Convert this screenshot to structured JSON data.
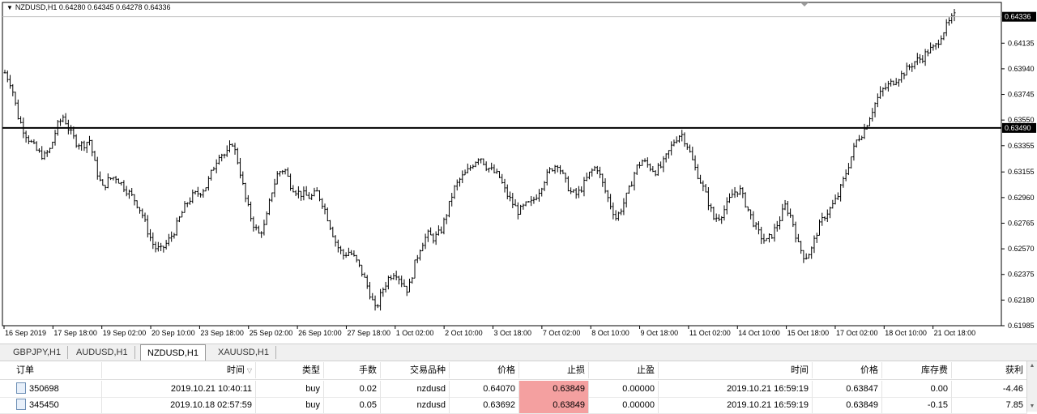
{
  "symbol_bar": {
    "arrow_icon": "dropdown-triangle-icon",
    "text": "NZDUSD,H1  0.64280 0.64345 0.64278 0.64336"
  },
  "chart_data": {
    "type": "bar",
    "title": "NZDUSD,H1",
    "ohlc_header": {
      "open": 0.6428,
      "high": 0.64345,
      "low": 0.64278,
      "close": 0.64336
    },
    "y_ticks": [
      "0.64135",
      "0.63940",
      "0.63745",
      "0.63550",
      "0.63355",
      "0.63155",
      "0.62960",
      "0.62765",
      "0.62570",
      "0.62375",
      "0.62180",
      "0.61985"
    ],
    "ylim": [
      0.61985,
      0.64445
    ],
    "x_ticks": [
      "16 Sep 2019",
      "17 Sep 18:00",
      "19 Sep 02:00",
      "20 Sep 10:00",
      "23 Sep 18:00",
      "25 Sep 02:00",
      "26 Sep 10:00",
      "27 Sep 18:00",
      "1 Oct 02:00",
      "2 Oct 10:00",
      "3 Oct 18:00",
      "7 Oct 02:00",
      "8 Oct 10:00",
      "9 Oct 18:00",
      "11 Oct 02:00",
      "14 Oct 10:00",
      "15 Oct 18:00",
      "17 Oct 02:00",
      "18 Oct 10:00",
      "21 Oct 18:00"
    ],
    "current_price": "0.64336",
    "hline_price": "0.63490",
    "close_path": [
      0.6391,
      0.6382,
      0.6358,
      0.6346,
      0.6338,
      0.6331,
      0.6327,
      0.6333,
      0.635,
      0.6358,
      0.6346,
      0.6338,
      0.6336,
      0.634,
      0.6318,
      0.6303,
      0.631,
      0.6312,
      0.6306,
      0.63,
      0.6294,
      0.6285,
      0.627,
      0.6258,
      0.6256,
      0.6262,
      0.627,
      0.6282,
      0.6292,
      0.6298,
      0.63,
      0.6305,
      0.6318,
      0.633,
      0.6328,
      0.6338,
      0.632,
      0.6295,
      0.6278,
      0.6268,
      0.6275,
      0.63,
      0.6315,
      0.6318,
      0.6305,
      0.63,
      0.6298,
      0.6296,
      0.63,
      0.629,
      0.6275,
      0.626,
      0.6252,
      0.6255,
      0.6248,
      0.6238,
      0.6225,
      0.621,
      0.6225,
      0.6235,
      0.624,
      0.6232,
      0.6225,
      0.6245,
      0.626,
      0.6268,
      0.6265,
      0.627,
      0.6285,
      0.6302,
      0.631,
      0.6315,
      0.6322,
      0.6328,
      0.632,
      0.6316,
      0.6312,
      0.63,
      0.6292,
      0.6285,
      0.629,
      0.6292,
      0.63,
      0.631,
      0.6318,
      0.6322,
      0.631,
      0.63,
      0.6298,
      0.6306,
      0.6315,
      0.632,
      0.6305,
      0.6292,
      0.628,
      0.629,
      0.6302,
      0.6318,
      0.6324,
      0.632,
      0.6316,
      0.632,
      0.633,
      0.634,
      0.6345,
      0.6335,
      0.632,
      0.6308,
      0.6295,
      0.628,
      0.6282,
      0.629,
      0.63,
      0.6302,
      0.629,
      0.6278,
      0.6268,
      0.6262,
      0.6268,
      0.6278,
      0.629,
      0.628,
      0.626,
      0.625,
      0.6256,
      0.6272,
      0.6282,
      0.6288,
      0.6296,
      0.631,
      0.6325,
      0.634,
      0.6346,
      0.6358,
      0.637,
      0.6378,
      0.6382,
      0.6386,
      0.639,
      0.6395,
      0.64,
      0.6402,
      0.6408,
      0.641,
      0.642,
      0.6428,
      0.6434
    ]
  },
  "tabs": [
    {
      "label": "GBPJPY,H1"
    },
    {
      "label": "AUDUSD,H1"
    },
    {
      "label": "NZDUSD,H1"
    },
    {
      "label": "XAUUSD,H1"
    }
  ],
  "table": {
    "headers": {
      "order": "订单",
      "time": "时间",
      "type": "类型",
      "lots": "手数",
      "symbol": "交易品种",
      "price": "价格",
      "sl": "止损",
      "tp": "止盈",
      "close_time": "时间",
      "close_price": "价格",
      "swap": "库存费",
      "profit": "获利"
    },
    "rows": [
      {
        "order": "350698",
        "time": "2019.10.21 10:40:11",
        "type": "buy",
        "lots": "0.02",
        "symbol": "nzdusd",
        "price": "0.64070",
        "sl": "0.63849",
        "tp": "0.00000",
        "close_time": "2019.10.21 16:59:19",
        "close_price": "0.63847",
        "swap": "0.00",
        "profit": "-4.46"
      },
      {
        "order": "345450",
        "time": "2019.10.18 02:57:59",
        "type": "buy",
        "lots": "0.05",
        "symbol": "nzdusd",
        "price": "0.63692",
        "sl": "0.63849",
        "tp": "0.00000",
        "close_time": "2019.10.21 16:59:19",
        "close_price": "0.63849",
        "swap": "-0.15",
        "profit": "7.85"
      }
    ]
  },
  "colors": {
    "stop_loss_bg": "#f4a0a0",
    "price_tag_bg": "#000000",
    "bar_color": "#000000"
  }
}
